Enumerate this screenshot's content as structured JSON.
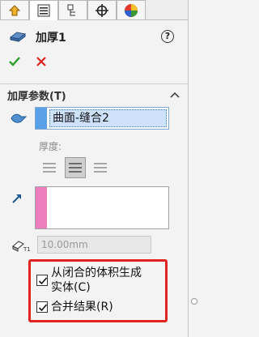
{
  "tabs": [
    {
      "id": "feature-manager",
      "icon": "feature-manager-icon"
    },
    {
      "id": "property-manager",
      "icon": "property-manager-icon",
      "active": true
    },
    {
      "id": "configuration-manager",
      "icon": "configuration-manager-icon"
    },
    {
      "id": "dimxpert-manager",
      "icon": "crosshair-icon"
    },
    {
      "id": "display-manager",
      "icon": "appearance-icon"
    }
  ],
  "feature": {
    "title": "加厚1",
    "help": "?"
  },
  "section": {
    "title": "加厚参数(T)",
    "face_item": "曲面-缝合2",
    "thickness_label": "厚度:",
    "thickness_value": "10.00mm"
  },
  "options": {
    "create_solid_label_line1": "从闭合的体积生成",
    "create_solid_label_line2": "实体(C)",
    "create_solid_checked": true,
    "merge_label": "合并结果(R)",
    "merge_checked": true
  },
  "colors": {
    "ok_green": "#2a9d2a",
    "cancel_red": "#d9231c",
    "highlight_red": "#e0231f",
    "face_list_blue": "#5aa0e6",
    "direction_pink": "#ee7fbf"
  }
}
